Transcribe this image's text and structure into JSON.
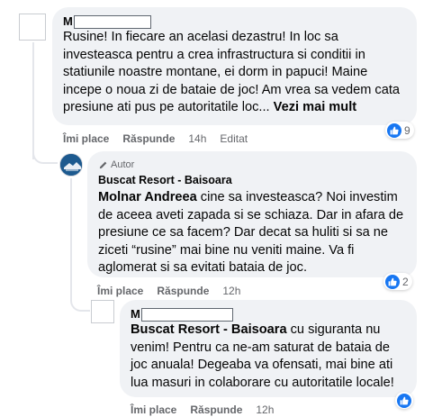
{
  "comment1": {
    "author_initial": "M",
    "text": "Rusine! In fiecare an acelasi dezastru! In loc sa investeasca pentru a crea infrastructura si conditii in statiunile noastre montane, ei dorm in papuci! Maine incepe o noua zi de bataie de joc! Am vrea sa vedem cata presiune ati pus pe autoritatile loc...",
    "see_more": "Vezi mai mult",
    "like_label": "Îmi place",
    "reply_label": "Răspunde",
    "time": "14h",
    "edited": "Editat",
    "reaction_count": "9"
  },
  "comment2": {
    "badge": "Autor",
    "author": "Buscat Resort - Baisoara",
    "mention": "Molnar Andreea",
    "text": " cine sa investeasca? Noi investim de aceea aveti zapada si se schiaza. Dar in afara de presiune ce sa facem? Dar decat sa huliti si sa ne ziceti “rusine” mai bine nu veniti maine. Va fi aglomerat si sa evitati bataia de joc.",
    "like_label": "Îmi place",
    "reply_label": "Răspunde",
    "time": "12h",
    "reaction_count": "2"
  },
  "comment3": {
    "author_initial": "M",
    "mention": "Buscat Resort - Baisoara",
    "text": " cu siguranta nu venim! Pentru ca ne-am saturat de bataia de joc anuala! Degeaba va ofensati, mai bine ati lua masuri in colaborare cu autoritatile locale!",
    "like_label": "Îmi place",
    "reply_label": "Răspunde",
    "time": "12h"
  },
  "colors": {
    "bubble": "#f0f2f5",
    "secondary_text": "#65676b",
    "like_blue": "#1877f2"
  }
}
